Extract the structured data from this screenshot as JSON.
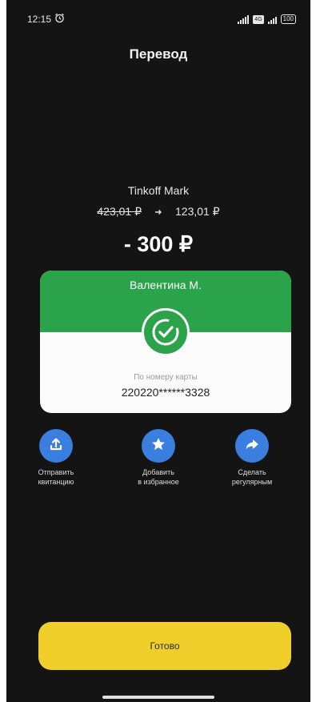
{
  "status_bar": {
    "time": "12:15",
    "battery": "100",
    "sim_label": "4G"
  },
  "header": {
    "title": "Перевод"
  },
  "transfer": {
    "account_name": "Tinkoff Mark",
    "balance_before": "423,01 ₽",
    "balance_after": "123,01 ₽",
    "amount": "- 300 ₽"
  },
  "recipient_card": {
    "name": "Валентина М.",
    "caption": "По номеру карты",
    "card_number": "220220******3328"
  },
  "actions": [
    {
      "label": "Отправить\nквитанцию",
      "icon": "upload-icon"
    },
    {
      "label": "Добавить\nв избранное",
      "icon": "star-icon"
    },
    {
      "label": "Сделать\nрегулярным",
      "icon": "forward-arrow-icon"
    }
  ],
  "footer": {
    "done_label": "Готово"
  },
  "colors": {
    "background": "#141414",
    "success_green": "#2ba34a",
    "action_blue": "#3a7ee0",
    "done_yellow": "#f0cf2b"
  }
}
